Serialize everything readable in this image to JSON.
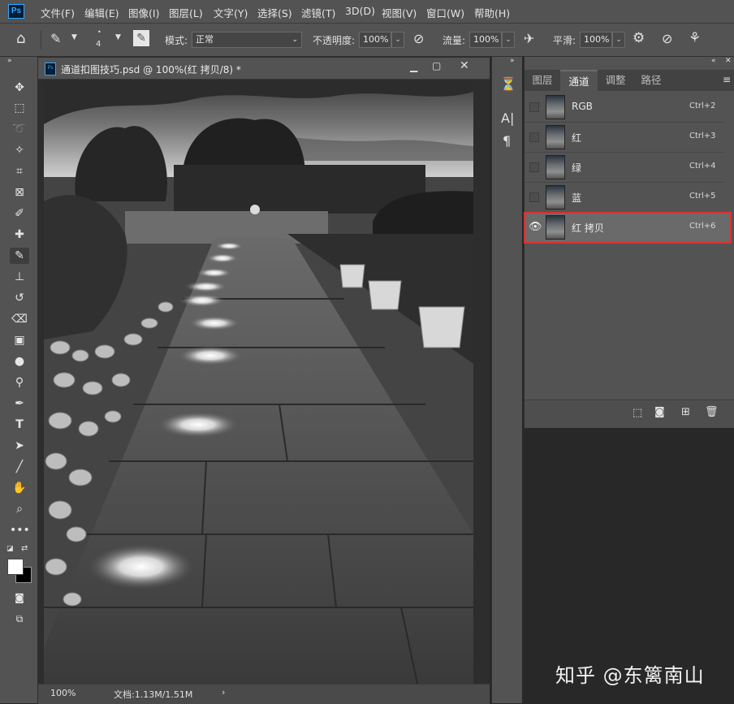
{
  "app": {
    "menu": [
      "文件(F)",
      "编辑(E)",
      "图像(I)",
      "图层(L)",
      "文字(Y)",
      "选择(S)",
      "滤镜(T)",
      "3D(D)",
      "视图(V)",
      "窗口(W)",
      "帮助(H)"
    ],
    "logo_text": "Ps"
  },
  "options": {
    "brush_size": "4",
    "mode_label": "模式:",
    "mode_value": "正常",
    "opacity_label": "不透明度:",
    "opacity_value": "100%",
    "flow_label": "流量:",
    "flow_value": "100%",
    "smooth_label": "平滑:",
    "smooth_value": "100%"
  },
  "document": {
    "title": "通道扣图技巧.psd @ 100%(红 拷贝/8) *",
    "zoom": "100%",
    "doc_info": "文档:1.13M/1.51M"
  },
  "panel": {
    "tabs": [
      "图层",
      "通道",
      "调整",
      "路径"
    ],
    "active_tab": "通道",
    "channels": [
      {
        "name": "RGB",
        "shortcut": "Ctrl+2",
        "visible": false
      },
      {
        "name": "红",
        "shortcut": "Ctrl+3",
        "visible": false
      },
      {
        "name": "绿",
        "shortcut": "Ctrl+4",
        "visible": false
      },
      {
        "name": "蓝",
        "shortcut": "Ctrl+5",
        "visible": false
      },
      {
        "name": "红 拷贝",
        "shortcut": "Ctrl+6",
        "visible": true,
        "selected": true
      }
    ]
  },
  "watermark": "知乎 @东篱南山",
  "colors": {
    "highlight": "#e03030",
    "ps_blue": "#31a8ff"
  }
}
